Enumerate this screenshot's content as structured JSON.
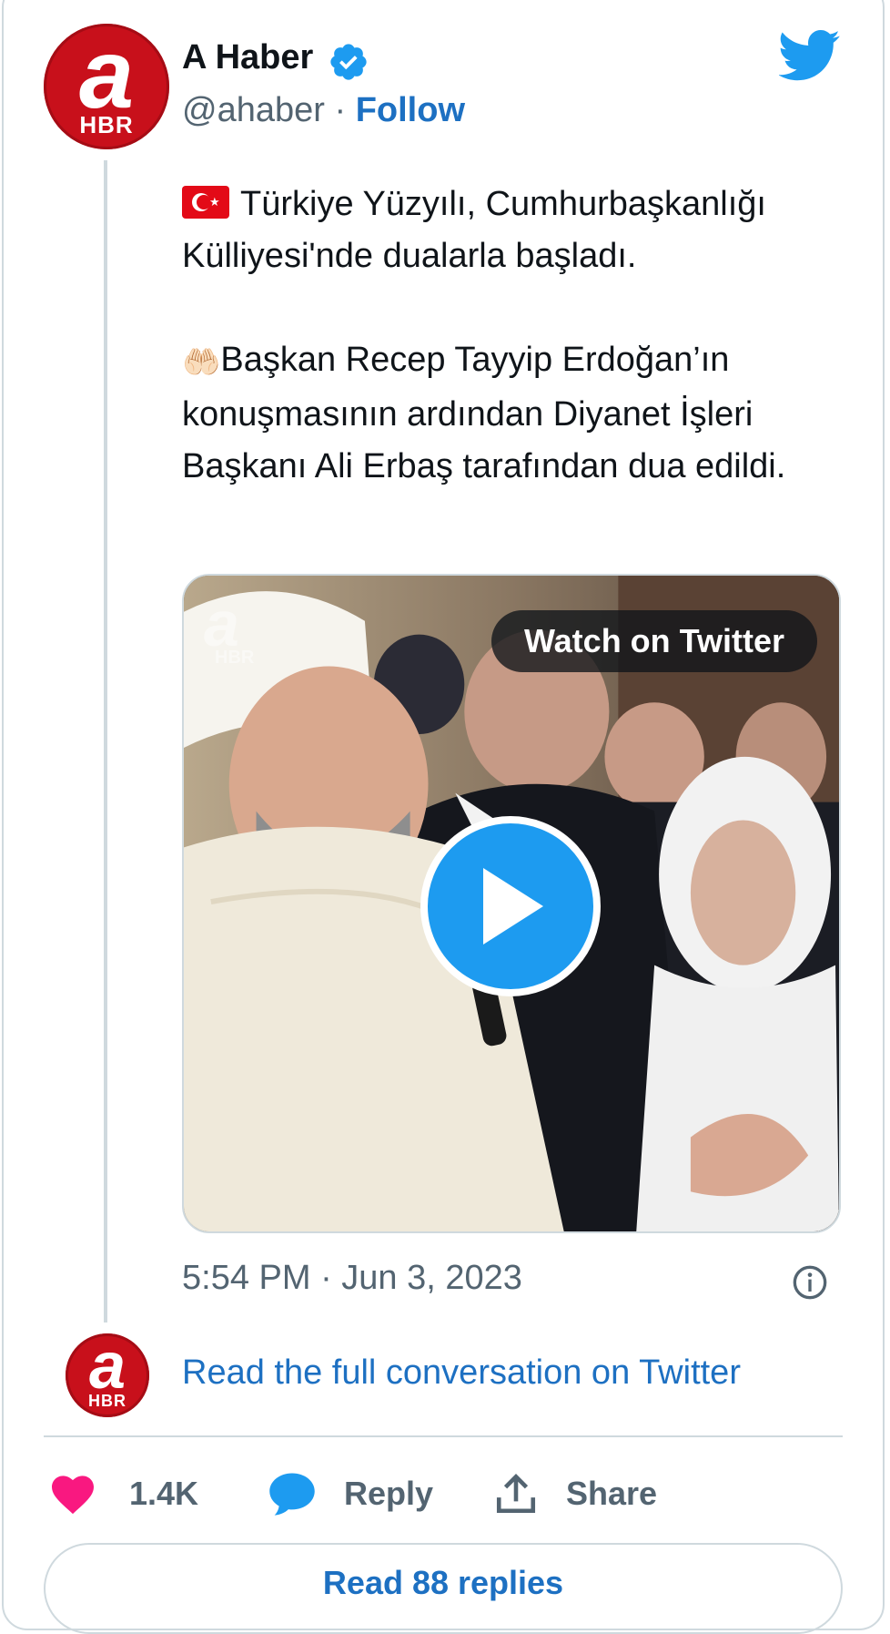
{
  "account": {
    "name": "A Haber",
    "handle": "@ahaber",
    "separator": "·",
    "follow_label": "Follow",
    "avatar_logo_letter": "a",
    "avatar_logo_text": "HBR",
    "verified_icon": "verified-badge-icon",
    "platform_icon": "twitter-bird-icon"
  },
  "tweet": {
    "line1": "Türkiye Yüzyılı, Cumhurbaşkanlığı Külliyesi'nde dualarla başladı.",
    "line2": "Başkan Recep Tayyip Erdoğan’ın konuşmasının ardından Diyanet İşleri Başkanı Ali Erbaş tarafından dua edildi.",
    "emoji1": "turkey-flag-icon",
    "emoji2": "🤲🏻"
  },
  "media": {
    "watch_label": "Watch on Twitter",
    "watermark_letter": "a",
    "watermark_text": "HBR",
    "play_icon": "play-icon"
  },
  "meta": {
    "timestamp": "5:54 PM · Jun 3, 2023",
    "info_icon": "info-icon"
  },
  "conversation": {
    "read_full_label": "Read the full conversation on Twitter"
  },
  "actions": {
    "likes_count": "1.4K",
    "reply_label": "Reply",
    "share_label": "Share",
    "read_replies_label": "Read 88 replies"
  },
  "colors": {
    "link": "#1d70c2",
    "twitter_blue": "#1d9bf0",
    "like_pink": "#f91880",
    "secondary_text": "#536471",
    "border": "#cfd9de",
    "brand_red": "#c8101b"
  }
}
